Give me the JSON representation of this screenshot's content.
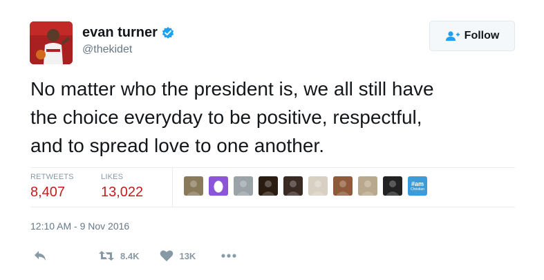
{
  "user": {
    "display_name": "evan turner",
    "handle": "@thekidet",
    "verified": true
  },
  "follow_button": {
    "label": "Follow"
  },
  "tweet": {
    "lines": [
      "No matter who the president is, we all still have",
      "the choice everyday to be positive, respectful,",
      "and to spread love to one another."
    ]
  },
  "stats": {
    "retweets_label": "RETWEETS",
    "retweets_value": "8,407",
    "likes_label": "LIKES",
    "likes_value": "13,022"
  },
  "likers": [
    {
      "kind": "photo",
      "color": "#8a7a5c"
    },
    {
      "kind": "egg",
      "color": "#8c54d6"
    },
    {
      "kind": "photo",
      "color": "#9aa3a8"
    },
    {
      "kind": "photo",
      "color": "#2a1c10"
    },
    {
      "kind": "photo",
      "color": "#3a2a24"
    },
    {
      "kind": "photo",
      "color": "#d9d0c4"
    },
    {
      "kind": "photo",
      "color": "#8e5a3a"
    },
    {
      "kind": "photo",
      "color": "#b8a98e"
    },
    {
      "kind": "photo",
      "color": "#222222"
    },
    {
      "kind": "badge",
      "color": "#3d9bd8",
      "text_top": "#am",
      "text_bottom": "Christian"
    }
  ],
  "timestamp": "12:10 AM - 9 Nov 2016",
  "actions": {
    "retweet_count": "8.4K",
    "like_count": "13K"
  },
  "colors": {
    "accent_red": "#c41c1c",
    "verified_blue": "#1da1f2",
    "muted": "#8899a6"
  }
}
